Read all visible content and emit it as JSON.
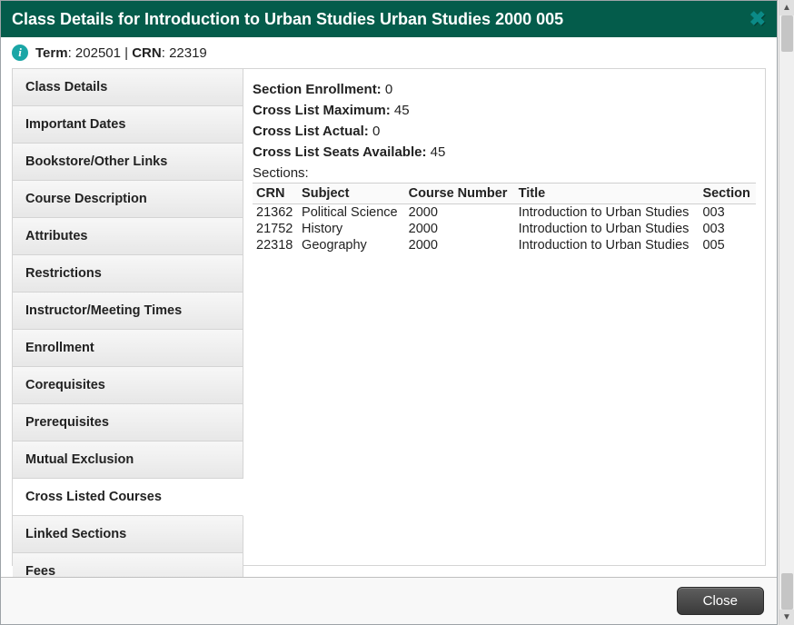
{
  "header": {
    "title": "Class Details for Introduction to Urban Studies Urban Studies 2000 005"
  },
  "meta": {
    "term_label": "Term",
    "term_value": "202501",
    "crn_label": "CRN",
    "crn_value": "22319"
  },
  "tabs": [
    {
      "label": "Class Details",
      "active": false
    },
    {
      "label": "Important Dates",
      "active": false
    },
    {
      "label": "Bookstore/Other Links",
      "active": false
    },
    {
      "label": "Course Description",
      "active": false
    },
    {
      "label": "Attributes",
      "active": false
    },
    {
      "label": "Restrictions",
      "active": false
    },
    {
      "label": "Instructor/Meeting Times",
      "active": false
    },
    {
      "label": "Enrollment",
      "active": false
    },
    {
      "label": "Corequisites",
      "active": false
    },
    {
      "label": "Prerequisites",
      "active": false
    },
    {
      "label": "Mutual Exclusion",
      "active": false
    },
    {
      "label": "Cross Listed Courses",
      "active": true
    },
    {
      "label": "Linked Sections",
      "active": false
    },
    {
      "label": "Fees",
      "active": false
    }
  ],
  "panel": {
    "section_enrollment_label": "Section Enrollment:",
    "section_enrollment_value": "0",
    "cross_list_max_label": "Cross List Maximum:",
    "cross_list_max_value": "45",
    "cross_list_actual_label": "Cross List Actual:",
    "cross_list_actual_value": "0",
    "cross_list_seats_label": "Cross List Seats Available:",
    "cross_list_seats_value": "45",
    "sections_label": "Sections:",
    "columns": {
      "crn": "CRN",
      "subject": "Subject",
      "course_number": "Course Number",
      "title": "Title",
      "section": "Section"
    },
    "rows": [
      {
        "crn": "21362",
        "subject": "Political Science",
        "course_number": "2000",
        "title": "Introduction to Urban Studies",
        "section": "003"
      },
      {
        "crn": "21752",
        "subject": "History",
        "course_number": "2000",
        "title": "Introduction to Urban Studies",
        "section": "003"
      },
      {
        "crn": "22318",
        "subject": "Geography",
        "course_number": "2000",
        "title": "Introduction to Urban Studies",
        "section": "005"
      }
    ]
  },
  "footer": {
    "close_label": "Close"
  }
}
